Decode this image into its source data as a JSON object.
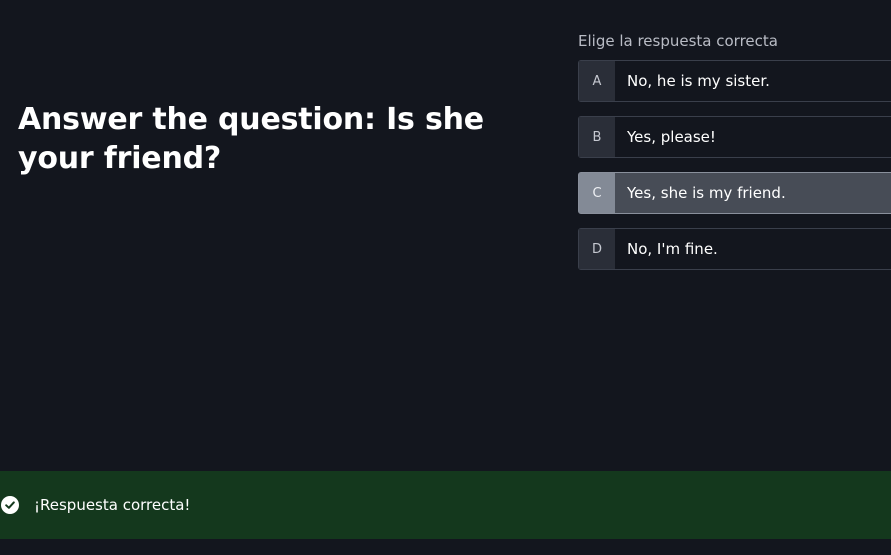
{
  "question": {
    "title": "Answer the question: Is she your friend?"
  },
  "quiz": {
    "prompt": "Elige la respuesta correcta",
    "options": [
      {
        "key": "A",
        "text": "No, he is my sister."
      },
      {
        "key": "B",
        "text": "Yes, please!"
      },
      {
        "key": "C",
        "text": "Yes, she is my friend.",
        "selected": true
      },
      {
        "key": "D",
        "text": "No, I'm fine."
      }
    ]
  },
  "feedback": {
    "message": "¡Respuesta correcta!",
    "icon": "check-circle-icon",
    "status_color": "#14381d"
  },
  "colors": {
    "background": "#13161e",
    "selected_option": "#474c56"
  }
}
